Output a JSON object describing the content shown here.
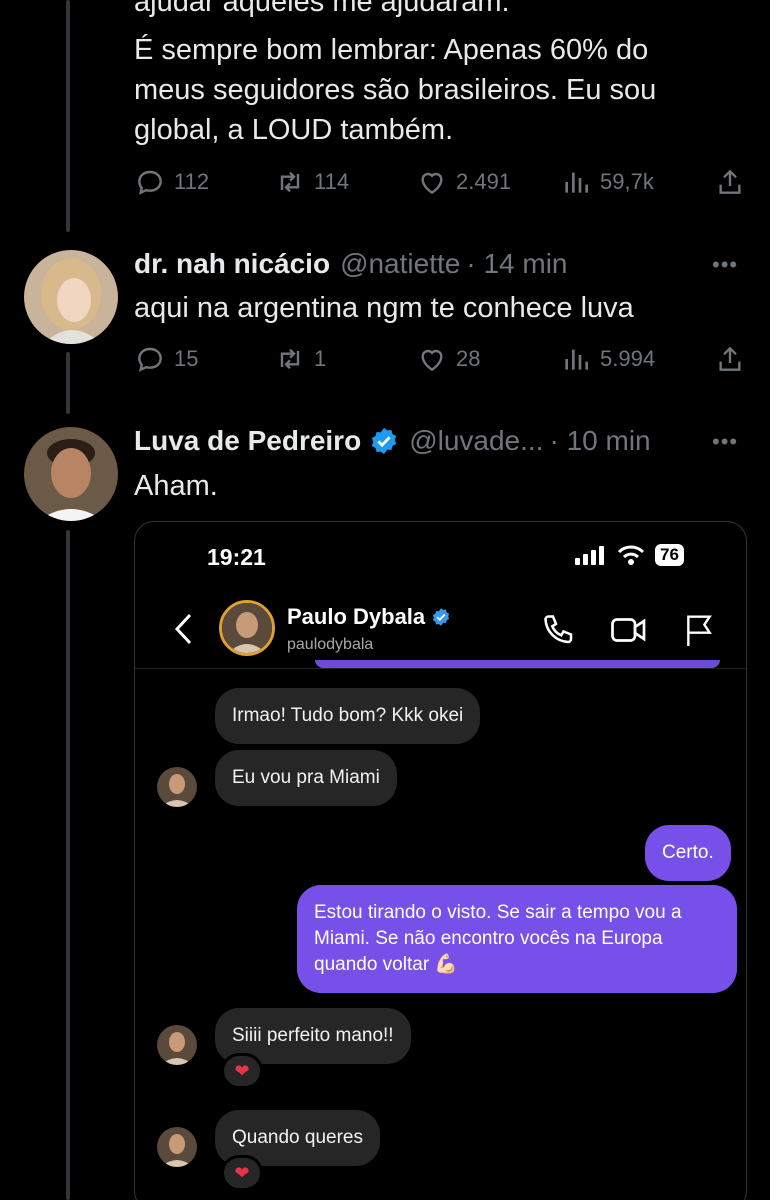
{
  "tweet1": {
    "text_partial": "ajudar aqueles me ajudaram.",
    "text_lines": [
      "É sempre bom lembrar: Apenas 60% do",
      "meus seguidores são brasileiros. Eu sou",
      "global, a LOUD também."
    ],
    "replies": "112",
    "retweets": "114",
    "likes": "2.491",
    "views": "59,7k"
  },
  "tweet2": {
    "name": "dr. nah nicácio",
    "handle": "@natiette",
    "time": "· 14 min",
    "text": "aqui na argentina ngm te conhece luva",
    "replies": "15",
    "retweets": "1",
    "likes": "28",
    "views": "5.994"
  },
  "tweet3": {
    "name": "Luva de Pedreiro",
    "handle": "@luvade...",
    "time": "· 10 min",
    "text": "Aham."
  },
  "more_label": "•••",
  "dm": {
    "status_time": "19:21",
    "battery": "76",
    "contact_name": "Paulo Dybala",
    "contact_username": "paulodybala",
    "messages": [
      {
        "from": "in",
        "text": "Irmao! Tudo bom? Kkk okei"
      },
      {
        "from": "in",
        "text": "Eu vou pra Miami"
      },
      {
        "from": "out",
        "text": "Certo."
      },
      {
        "from": "out",
        "text": "Estou tirando o visto. Se sair a tempo vou a Miami. Se não encontro vocês na Europa quando voltar 💪🏻"
      },
      {
        "from": "in",
        "text": "Siiii perfeito mano!!"
      },
      {
        "from": "in",
        "text": "Quando queres"
      }
    ],
    "reaction": "❤"
  },
  "colors": {
    "background": "#000000",
    "text": "#e7e9ea",
    "muted": "#71767b",
    "verified": "#1d9bf0",
    "dm_outgoing": "#7650e8",
    "dm_incoming": "#262626"
  }
}
